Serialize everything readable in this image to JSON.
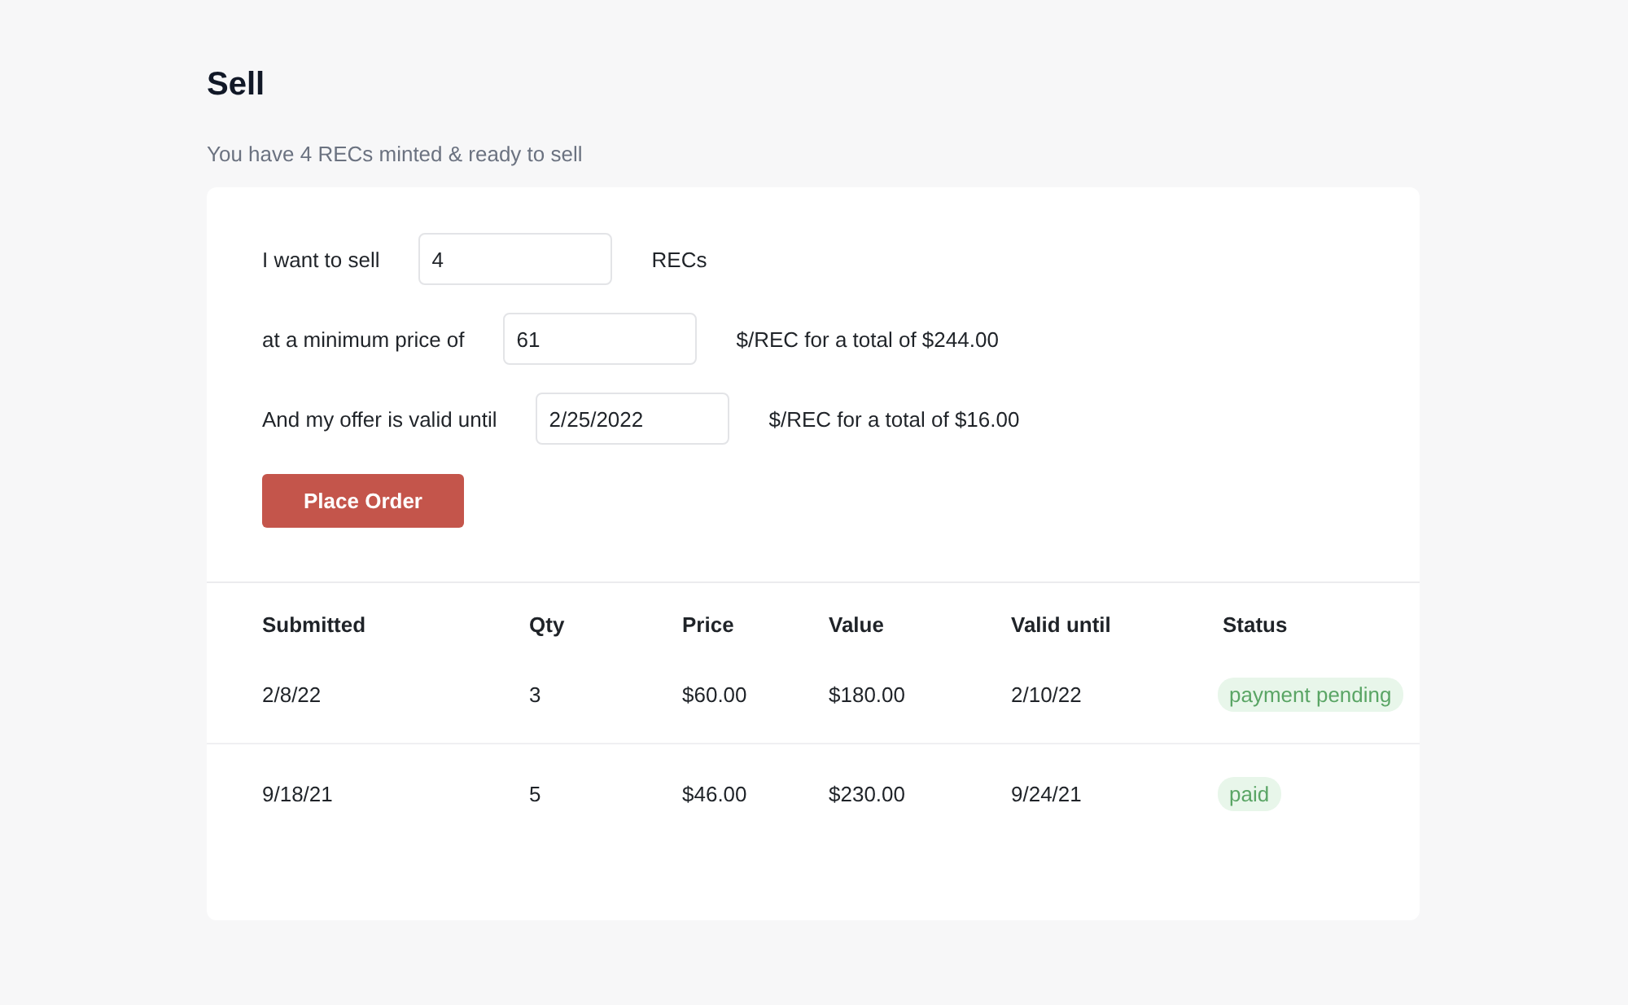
{
  "page": {
    "title": "Sell",
    "subtitle": "You have 4 RECs minted & ready to sell"
  },
  "form": {
    "rows": [
      {
        "label": "I want to sell",
        "value": "4",
        "suffix": "RECs"
      },
      {
        "label": "at a minimum price of",
        "value": "61",
        "suffix": "$/REC for a total of $244.00"
      },
      {
        "label": "And my offer is valid until",
        "value": "2/25/2022",
        "suffix": "$/REC for a total of $16.00"
      }
    ],
    "button": "Place Order"
  },
  "table": {
    "columns": [
      "Submitted",
      "Qty",
      "Price",
      "Value",
      "Valid until",
      "Status"
    ],
    "rows": [
      {
        "cells": [
          "2/8/22",
          "3",
          "$60.00",
          "$180.00",
          "2/10/22"
        ],
        "status": "payment pending"
      },
      {
        "cells": [
          "9/18/21",
          "5",
          "$46.00",
          "$230.00",
          "9/24/21"
        ],
        "status": "paid"
      }
    ]
  }
}
